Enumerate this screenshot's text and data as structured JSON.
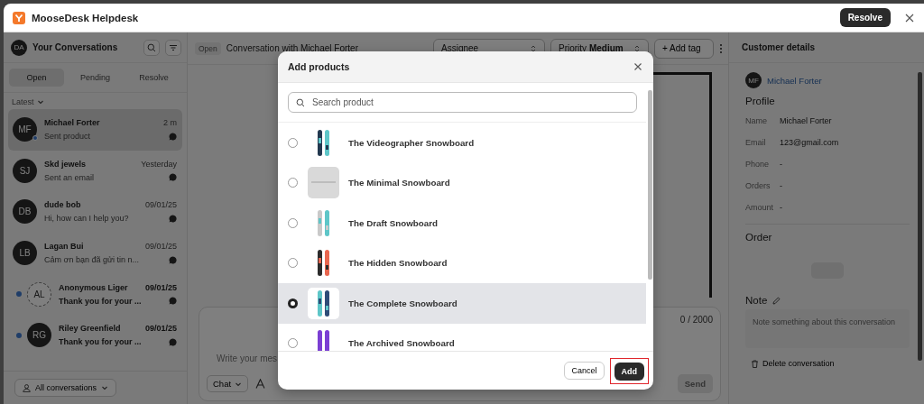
{
  "window": {
    "title": "MooseDesk Helpdesk",
    "action": "Resolve"
  },
  "sidebar": {
    "user_initials": "DA",
    "title": "Your Conversations",
    "tabs": [
      {
        "label": "Open",
        "selected": true
      },
      {
        "label": "Pending",
        "selected": false
      },
      {
        "label": "Resolve",
        "selected": false
      }
    ],
    "sort": "Latest",
    "conversations": [
      {
        "initials": "MF",
        "name": "Michael Forter",
        "time": "2 m",
        "preview": "Sent product",
        "selected": true,
        "unread": false,
        "online": true,
        "anonymous": false
      },
      {
        "initials": "SJ",
        "name": "Skd jewels",
        "time": "Yesterday",
        "preview": "Sent an email",
        "selected": false,
        "unread": false,
        "online": false,
        "anonymous": false
      },
      {
        "initials": "DB",
        "name": "dude bob",
        "time": "09/01/25",
        "preview": "Hi, how can I help you?",
        "selected": false,
        "unread": false,
        "online": false,
        "anonymous": false
      },
      {
        "initials": "LB",
        "name": "Lagan Bui",
        "time": "09/01/25",
        "preview": "Cảm ơn bạn đã gửi tin n...",
        "selected": false,
        "unread": false,
        "online": false,
        "anonymous": false
      },
      {
        "initials": "AL",
        "name": "Anonymous Liger",
        "time": "09/01/25",
        "preview": "Thank you for your ...",
        "selected": false,
        "unread": true,
        "online": false,
        "anonymous": true
      },
      {
        "initials": "RG",
        "name": "Riley Greenfield",
        "time": "09/01/25",
        "preview": "Thank you for your ...",
        "selected": false,
        "unread": true,
        "online": false,
        "anonymous": false
      }
    ],
    "filter": "All conversations"
  },
  "conversation": {
    "status": "Open",
    "title": "Conversation with Michael Forter",
    "assignee_placeholder": "Assignee",
    "priority_label": "Priority",
    "priority": "Medium",
    "add_tag": "+ Add tag",
    "composer": {
      "counter": "0 / 2000",
      "placeholder": "Write your mes",
      "channel": "Chat",
      "send": "Send",
      "send_disabled": true
    }
  },
  "customer": {
    "title": "Customer details",
    "initials": "MF",
    "name": "Michael Forter",
    "profile_heading": "Profile",
    "fields": [
      {
        "label": "Name",
        "value": "Michael Forter"
      },
      {
        "label": "Email",
        "value": "123@gmail.com"
      },
      {
        "label": "Phone",
        "value": "-"
      },
      {
        "label": "Orders",
        "value": "-"
      },
      {
        "label": "Amount",
        "value": "-"
      }
    ],
    "order_heading": "Order",
    "note_heading": "Note",
    "note_placeholder": "Note something about this conversation",
    "delete": "Delete conversation"
  },
  "modal": {
    "title": "Add products",
    "search_placeholder": "Search product",
    "products": [
      {
        "name": "The Videographer Snowboard",
        "selected": false
      },
      {
        "name": "The Minimal Snowboard",
        "selected": false
      },
      {
        "name": "The Draft Snowboard",
        "selected": false
      },
      {
        "name": "The Hidden Snowboard",
        "selected": false
      },
      {
        "name": "The Complete Snowboard",
        "selected": true
      },
      {
        "name": "The Archived Snowboard",
        "selected": false
      }
    ],
    "cancel": "Cancel",
    "add": "Add"
  }
}
